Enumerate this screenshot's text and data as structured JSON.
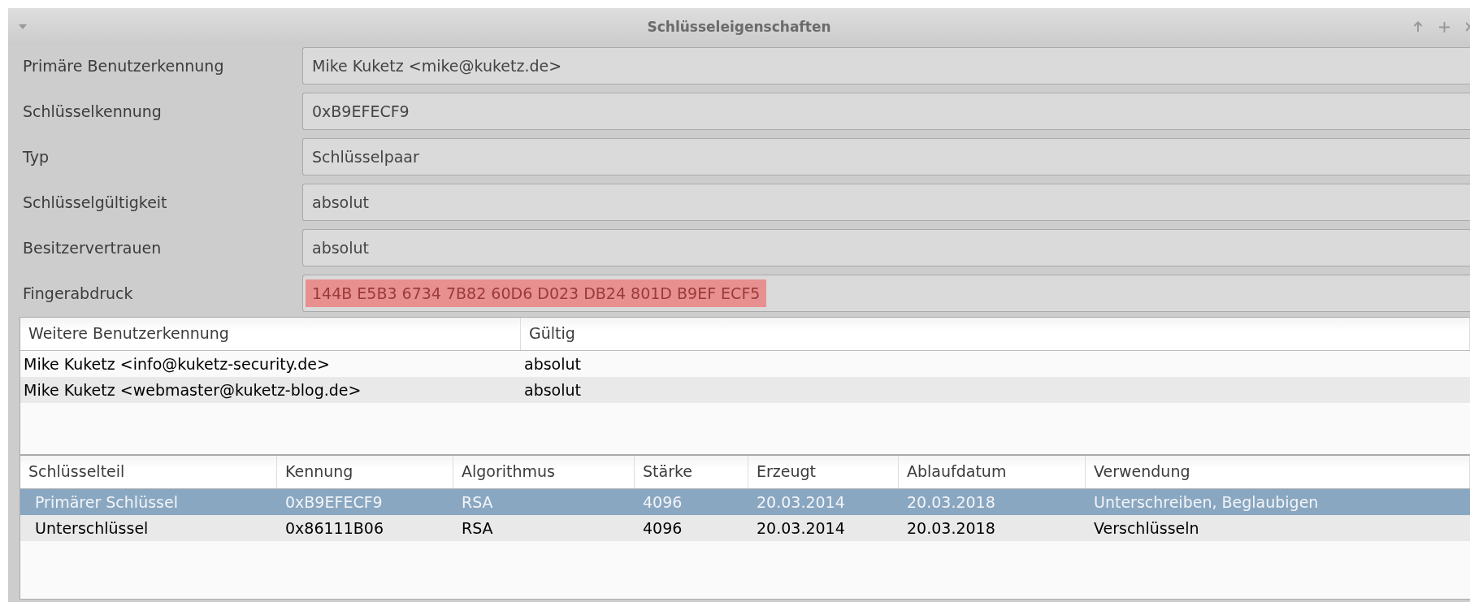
{
  "window": {
    "title": "Schlüsseleigenschaften"
  },
  "fields": [
    {
      "label": "Primäre Benutzerkennung",
      "value": "Mike Kuketz <mike@kuketz.de>",
      "highlighted": false
    },
    {
      "label": "Schlüsselkennung",
      "value": "0xB9EFECF9",
      "highlighted": false
    },
    {
      "label": "Typ",
      "value": "Schlüsselpaar",
      "highlighted": false
    },
    {
      "label": "Schlüsselgültigkeit",
      "value": "absolut",
      "highlighted": false
    },
    {
      "label": "Besitzervertrauen",
      "value": "absolut",
      "highlighted": false
    },
    {
      "label": "Fingerabdruck",
      "value": "144B E5B3 6734 7B82 60D6 D023 DB24 801D B9EF ECF5",
      "highlighted": true
    }
  ],
  "user_ids_table": {
    "columns": [
      "Weitere Benutzerkennung",
      "Gültig"
    ],
    "rows": [
      {
        "cells": [
          "Mike Kuketz <info@kuketz-security.de>",
          "absolut"
        ]
      },
      {
        "cells": [
          "Mike Kuketz <webmaster@kuketz-blog.de>",
          "absolut"
        ]
      }
    ]
  },
  "subkeys_table": {
    "columns": [
      "Schlüsselteil",
      "Kennung",
      "Algorithmus",
      "Stärke",
      "Erzeugt",
      "Ablaufdatum",
      "Verwendung"
    ],
    "rows": [
      {
        "cells": [
          "Primärer Schlüssel",
          "0xB9EFECF9",
          "RSA",
          "4096",
          "20.03.2014",
          "20.03.2018",
          "Unterschreiben, Beglaubigen"
        ],
        "selected": true
      },
      {
        "cells": [
          "Unterschlüssel",
          "0x86111B06",
          "RSA",
          "4096",
          "20.03.2014",
          "20.03.2018",
          "Verschlüsseln"
        ],
        "selected": false
      }
    ]
  }
}
